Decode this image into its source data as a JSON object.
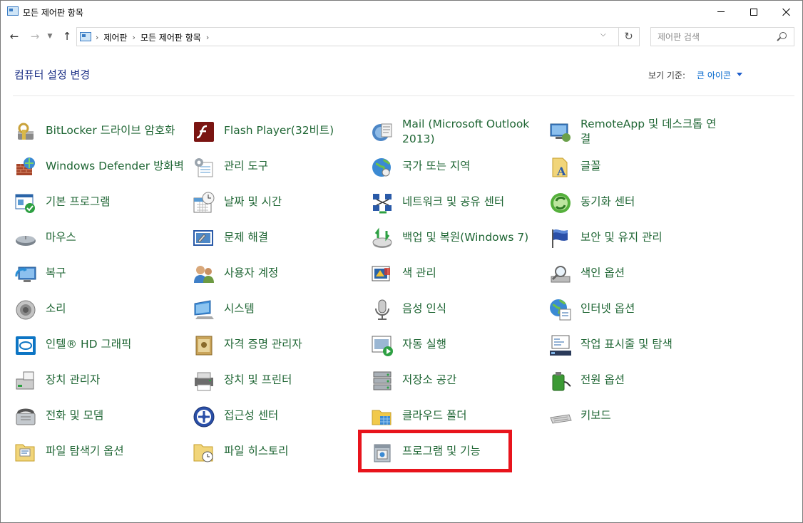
{
  "window": {
    "title": "모든 제어판 항목"
  },
  "nav": {
    "breadcrumbs": [
      "제어판",
      "모든 제어판 항목"
    ],
    "search_placeholder": "제어판 검색"
  },
  "header": {
    "title": "컴퓨터 설정 변경",
    "view_by_label": "보기 기준:",
    "view_by_value": "큰 아이콘"
  },
  "items": [
    {
      "label": "BitLocker 드라이브 암호화",
      "icon": "bitlocker-icon"
    },
    {
      "label": "Flash Player(32비트)",
      "icon": "flash-player-icon"
    },
    {
      "label": "Mail (Microsoft Outlook 2013)",
      "icon": "mail-icon"
    },
    {
      "label": "RemoteApp 및 데스크톱 연결",
      "icon": "remoteapp-icon"
    },
    {
      "label": "Windows Defender 방화벽",
      "icon": "firewall-icon"
    },
    {
      "label": "관리 도구",
      "icon": "admin-tools-icon"
    },
    {
      "label": "국가 또는 지역",
      "icon": "region-icon"
    },
    {
      "label": "글꼴",
      "icon": "fonts-icon"
    },
    {
      "label": "기본 프로그램",
      "icon": "default-programs-icon"
    },
    {
      "label": "날짜 및 시간",
      "icon": "date-time-icon"
    },
    {
      "label": "네트워크 및 공유 센터",
      "icon": "network-icon"
    },
    {
      "label": "동기화 센터",
      "icon": "sync-center-icon"
    },
    {
      "label": "마우스",
      "icon": "mouse-icon"
    },
    {
      "label": "문제 해결",
      "icon": "troubleshooting-icon"
    },
    {
      "label": "백업 및 복원(Windows 7)",
      "icon": "backup-icon"
    },
    {
      "label": "보안 및 유지 관리",
      "icon": "security-flag-icon"
    },
    {
      "label": "복구",
      "icon": "recovery-icon"
    },
    {
      "label": "사용자 계정",
      "icon": "user-accounts-icon"
    },
    {
      "label": "색 관리",
      "icon": "color-management-icon"
    },
    {
      "label": "색인 옵션",
      "icon": "indexing-icon"
    },
    {
      "label": "소리",
      "icon": "sound-icon"
    },
    {
      "label": "시스템",
      "icon": "system-icon"
    },
    {
      "label": "음성 인식",
      "icon": "speech-icon"
    },
    {
      "label": "인터넷 옵션",
      "icon": "internet-options-icon"
    },
    {
      "label": "인텔® HD 그래픽",
      "icon": "intel-graphics-icon"
    },
    {
      "label": "자격 증명 관리자",
      "icon": "credential-manager-icon"
    },
    {
      "label": "자동 실행",
      "icon": "autoplay-icon"
    },
    {
      "label": "작업 표시줄 및 탐색",
      "icon": "taskbar-icon"
    },
    {
      "label": "장치 관리자",
      "icon": "device-manager-icon"
    },
    {
      "label": "장치 및 프린터",
      "icon": "printer-icon"
    },
    {
      "label": "저장소 공간",
      "icon": "storage-spaces-icon"
    },
    {
      "label": "전원 옵션",
      "icon": "power-icon"
    },
    {
      "label": "전화 및 모뎀",
      "icon": "phone-modem-icon"
    },
    {
      "label": "접근성 센터",
      "icon": "ease-of-access-icon"
    },
    {
      "label": "클라우드 폴더",
      "icon": "cloud-folder-icon"
    },
    {
      "label": "키보드",
      "icon": "keyboard-icon"
    },
    {
      "label": "파일 탐색기 옵션",
      "icon": "folder-options-icon"
    },
    {
      "label": "파일 히스토리",
      "icon": "file-history-icon"
    },
    {
      "label": "프로그램 및 기능",
      "icon": "programs-features-icon"
    }
  ],
  "colors": {
    "link": "#1f6634",
    "title": "#1e3287",
    "highlight": "#e8141c"
  }
}
